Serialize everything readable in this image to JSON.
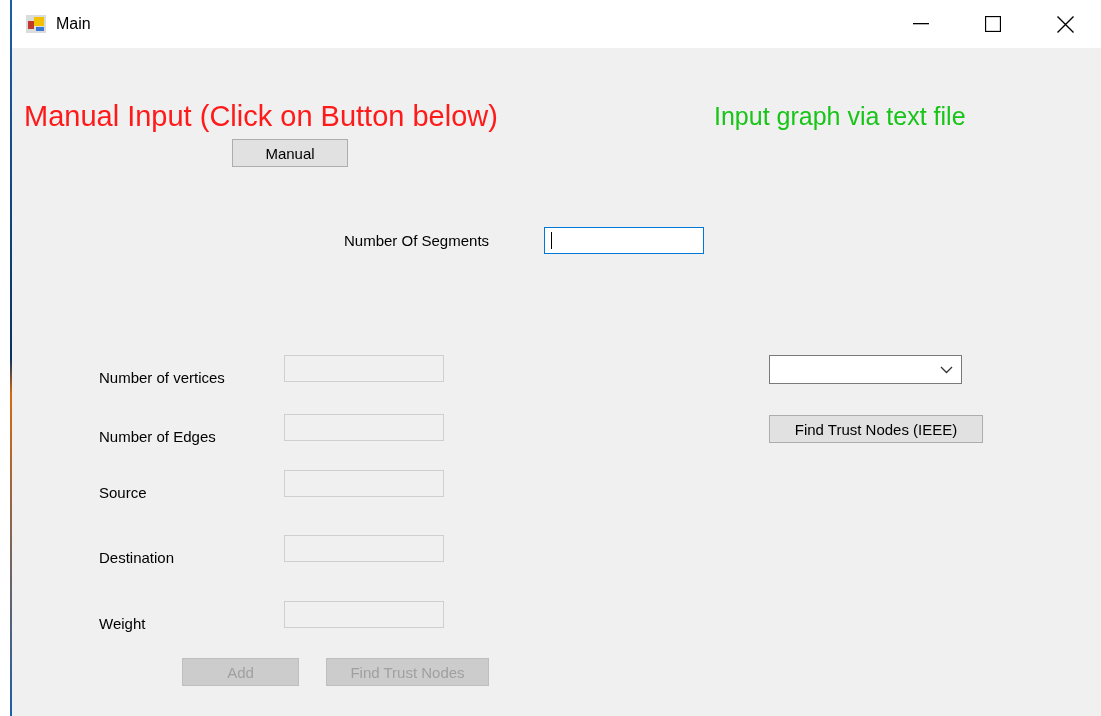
{
  "window": {
    "title": "Main"
  },
  "manual_heading": "Manual Input (Click on Button below)",
  "file_heading": "Input graph via text file",
  "manual_button": {
    "label": "Manual",
    "disabled": false
  },
  "segments": {
    "label": "Number Of Segments",
    "focused": true
  },
  "fields": [
    {
      "label": "Number of vertices",
      "disabled": true
    },
    {
      "label": "Number of Edges",
      "disabled": true
    },
    {
      "label": "Source",
      "disabled": true
    },
    {
      "label": "Destination",
      "disabled": true
    },
    {
      "label": "Weight",
      "disabled": true
    }
  ],
  "actions": [
    {
      "label": "Add",
      "disabled": true
    },
    {
      "label": "Find Trust Nodes",
      "disabled": true
    }
  ],
  "ieee_button": {
    "label": "Find Trust Nodes (IEEE)",
    "disabled": false
  }
}
